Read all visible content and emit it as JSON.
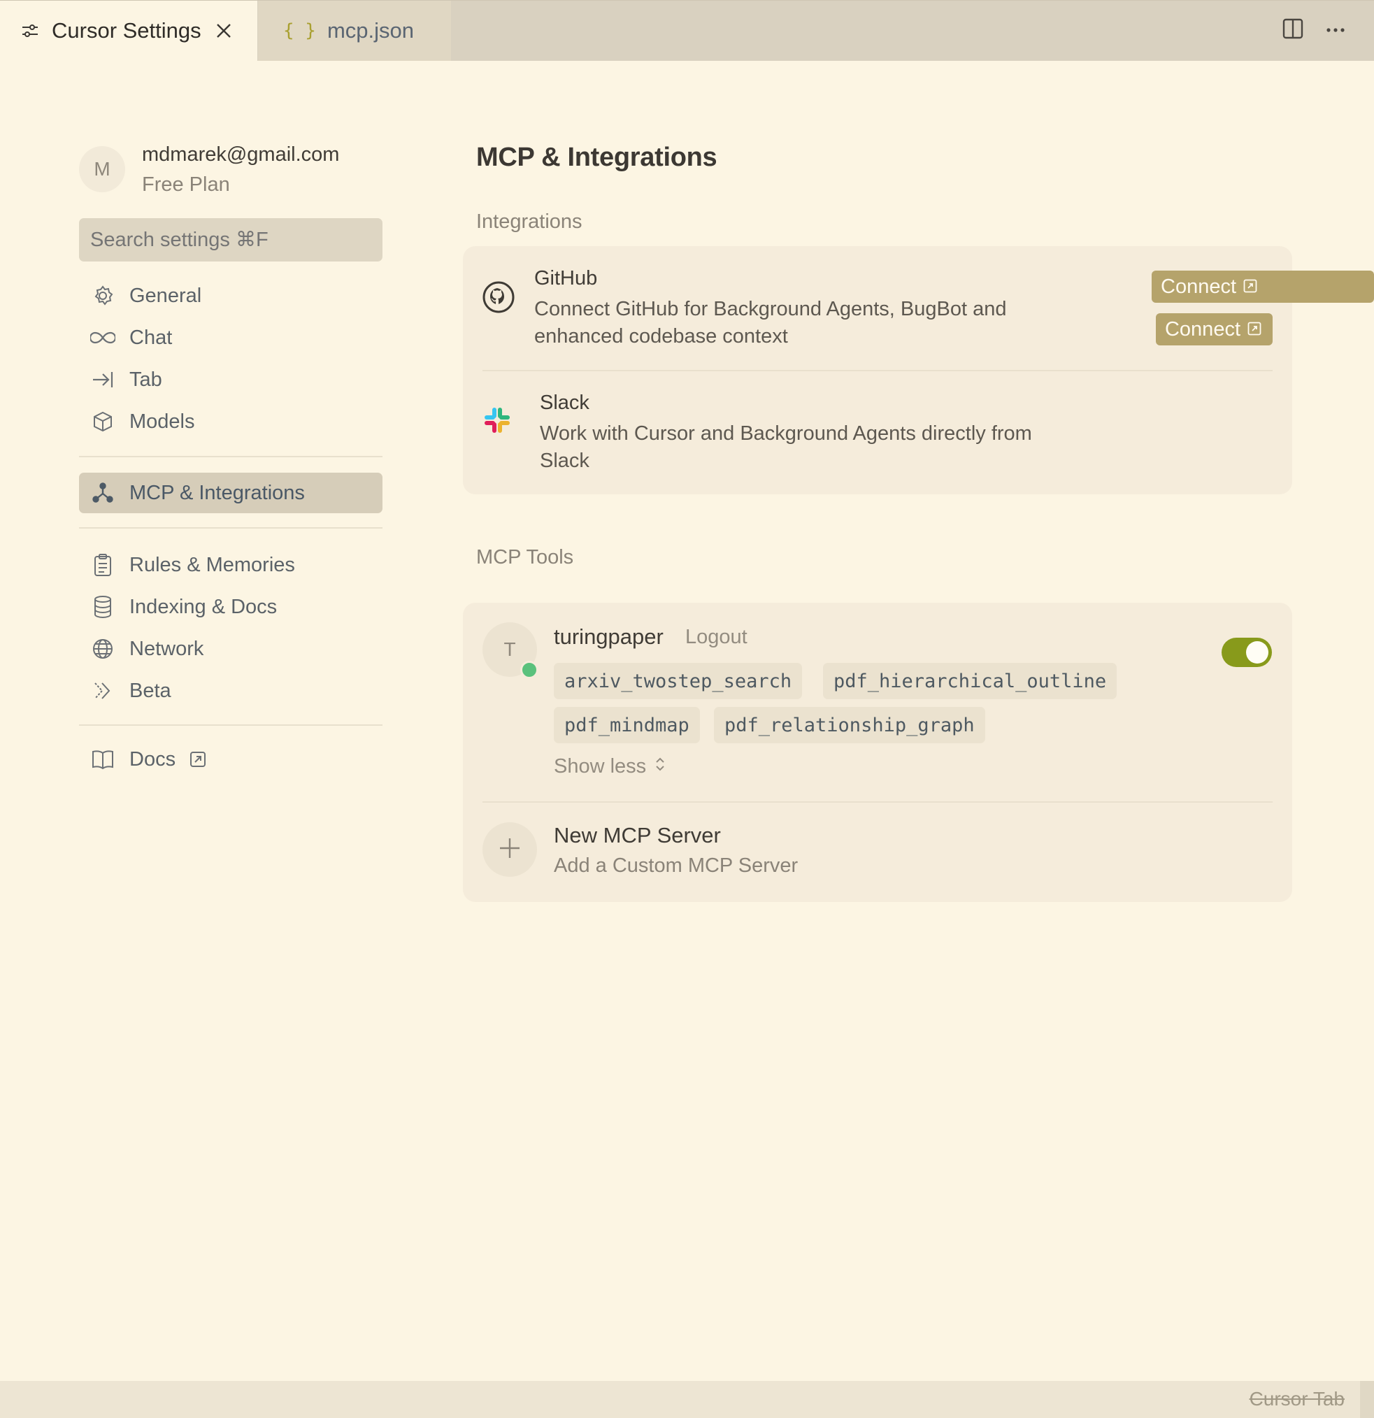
{
  "tabs": [
    {
      "label": "Cursor Settings",
      "icon": "sliders-icon",
      "active": true
    },
    {
      "label": "mcp.json",
      "icon": "braces-icon",
      "active": false
    }
  ],
  "tab_icon_text": "{ }",
  "account": {
    "initial": "M",
    "email": "mdmarek@gmail.com",
    "plan": "Free Plan"
  },
  "search": {
    "placeholder": "Search settings ⌘F"
  },
  "sidebar": {
    "items": [
      {
        "label": "General",
        "icon": "gear-icon"
      },
      {
        "label": "Chat",
        "icon": "infinity-icon"
      },
      {
        "label": "Tab",
        "icon": "arrow-right-to-line-icon"
      },
      {
        "label": "Models",
        "icon": "cube-icon"
      },
      {
        "label": "MCP & Integrations",
        "icon": "network-nodes-icon",
        "active": true
      },
      {
        "label": "Rules & Memories",
        "icon": "clipboard-icon"
      },
      {
        "label": "Indexing & Docs",
        "icon": "database-icon"
      },
      {
        "label": "Network",
        "icon": "globe-icon"
      },
      {
        "label": "Beta",
        "icon": "double-chevron-icon"
      },
      {
        "label": "Docs",
        "icon": "book-icon",
        "external": true
      }
    ]
  },
  "main": {
    "title": "MCP & Integrations",
    "integrations_label": "Integrations",
    "integrations": [
      {
        "name": "GitHub",
        "description": "Connect GitHub for Background Agents, BugBot and enhanced codebase context",
        "button": "Connect",
        "icon": "github-icon"
      },
      {
        "name": "Slack",
        "description": "Work with Cursor and Background Agents directly from Slack",
        "button": "Connect",
        "icon": "slack-icon"
      }
    ],
    "mcp_tools_label": "MCP Tools",
    "server": {
      "initial": "T",
      "name": "turingpaper",
      "logout": "Logout",
      "enabled": true,
      "tools": [
        "arxiv_twostep_search",
        "pdf_hierarchical_outline",
        "pdf_mindmap",
        "pdf_relationship_graph"
      ],
      "show_less": "Show less"
    },
    "new_server": {
      "title": "New MCP Server",
      "description": "Add a Custom MCP Server"
    }
  },
  "statusbar": {
    "text": "Cursor Tab"
  },
  "colors": {
    "background": "#fcf5e3",
    "connect_button": "#b5a36b",
    "toggle_on": "#889a1b",
    "status_online": "#5ac17c"
  }
}
